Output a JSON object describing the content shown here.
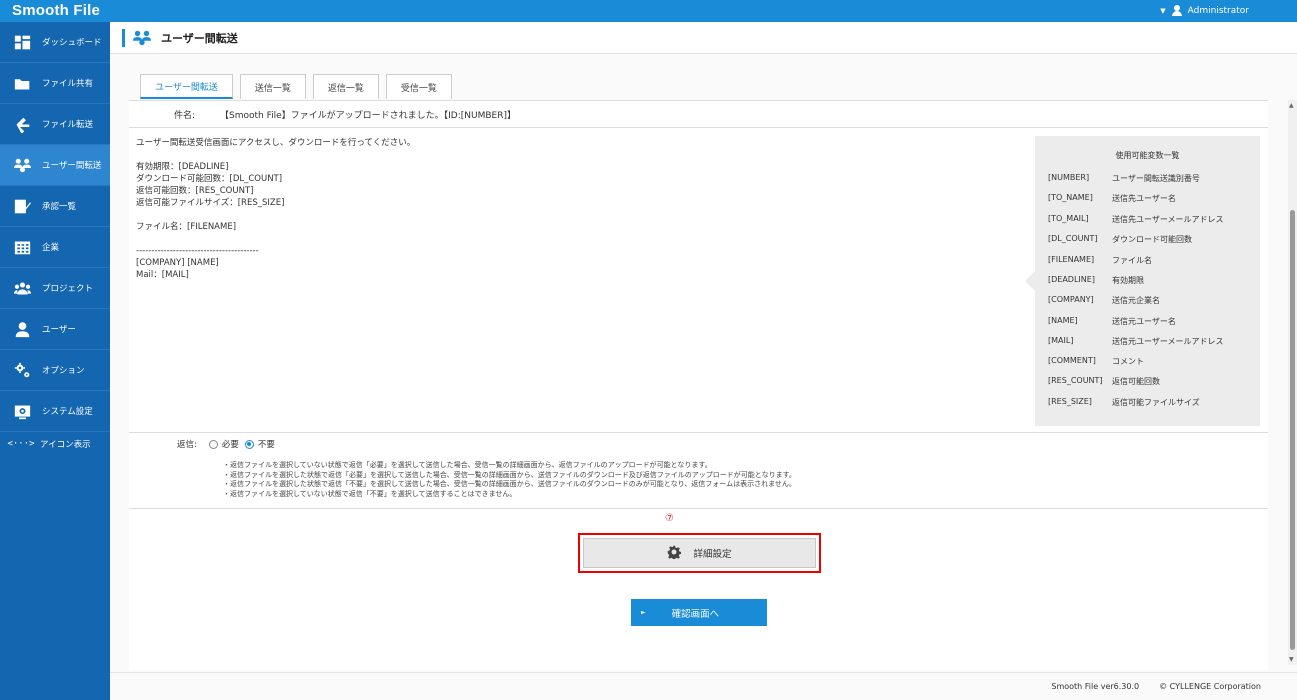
{
  "app": {
    "logo": "Smooth File",
    "user_caret": "▼",
    "user_name": "Administrator"
  },
  "sidebar": {
    "items": [
      {
        "label": "ダッシュボード",
        "icon": "dashboard-icon"
      },
      {
        "label": "ファイル共有",
        "icon": "folder-icon"
      },
      {
        "label": "ファイル転送",
        "icon": "transfer-icon"
      },
      {
        "label": "ユーザー間転送",
        "icon": "user-transfer-icon"
      },
      {
        "label": "承認一覧",
        "icon": "approval-icon"
      },
      {
        "label": "企業",
        "icon": "building-icon"
      },
      {
        "label": "プロジェクト",
        "icon": "project-icon"
      },
      {
        "label": "ユーザー",
        "icon": "user-icon"
      },
      {
        "label": "オプション",
        "icon": "options-icon"
      },
      {
        "label": "システム設定",
        "icon": "system-settings-icon"
      }
    ],
    "icon_toggle": {
      "glyph": "<···>",
      "label": "アイコン表示"
    }
  },
  "header": {
    "title": "ユーザー間転送"
  },
  "tabs": [
    {
      "label": "ユーザー間転送"
    },
    {
      "label": "送信一覧"
    },
    {
      "label": "返信一覧"
    },
    {
      "label": "受信一覧"
    }
  ],
  "subject": {
    "label": "件名:",
    "value": "【Smooth File】ファイルがアップロードされました。【ID:[NUMBER]】"
  },
  "body": {
    "text": "ユーザー間転送受信画面にアクセスし、ダウンロードを行ってください。\n\n有効期限：[DEADLINE]\nダウンロード可能回数：[DL_COUNT]\n返信可能回数：[RES_COUNT]\n返信可能ファイルサイズ：[RES_SIZE]\n\nファイル名：[FILENAME]\n\n----------------------------------------\n[COMPANY] [NAME]\nMail：[MAIL]"
  },
  "variables": {
    "title": "使用可能変数一覧",
    "rows": [
      {
        "key": "[NUMBER]",
        "desc": "ユーザー間転送識別番号"
      },
      {
        "key": "[TO_NAME]",
        "desc": "送信先ユーザー名"
      },
      {
        "key": "[TO_MAIL]",
        "desc": "送信先ユーザーメールアドレス"
      },
      {
        "key": "[DL_COUNT]",
        "desc": "ダウンロード可能回数"
      },
      {
        "key": "[FILENAME]",
        "desc": "ファイル名"
      },
      {
        "key": "[DEADLINE]",
        "desc": "有効期限"
      },
      {
        "key": "[COMPANY]",
        "desc": "送信元企業名"
      },
      {
        "key": "[NAME]",
        "desc": "送信元ユーザー名"
      },
      {
        "key": "[MAIL]",
        "desc": "送信元ユーザーメールアドレス"
      },
      {
        "key": "[COMMENT]",
        "desc": "コメント"
      },
      {
        "key": "[RES_COUNT]",
        "desc": "返信可能回数"
      },
      {
        "key": "[RES_SIZE]",
        "desc": "返信可能ファイルサイズ"
      }
    ]
  },
  "reply": {
    "label": "返信:",
    "option_required": "必要",
    "option_not_required": "不要",
    "selected": "不要",
    "notes": [
      "・返信ファイルを選択していない状態で返信「必要」を選択して送信した場合、受信一覧の詳細画面から、返信ファイルのアップロードが可能となります。",
      "・返信ファイルを選択した状態で返信「必要」を選択して送信した場合、受信一覧の詳細画面から、送信ファイルのダウンロード及び返信ファイルのアップロードが可能となります。",
      "・返信ファイルを選択した状態で返信「不要」を選択して送信した場合、受信一覧の詳細画面から、送信ファイルのダウンロードのみが可能となり、返信フォームは表示されません。",
      "・返信ファイルを選択していない状態で返信「不要」を選択して送信することはできません。"
    ]
  },
  "marker": "⑦",
  "detail_button": {
    "label": "詳細設定"
  },
  "confirm_button": {
    "arrow": "►",
    "label": "確認画面へ"
  },
  "scrollbar": {
    "up": "▲",
    "down": "▼"
  },
  "footer": {
    "version": "Smooth File ver6.30.0",
    "copyright": "© CYLLENGE Corporation"
  },
  "colors": {
    "topbar": "#1a8bd6",
    "sidebar": "#1566b0",
    "sidebar_active": "#2e86d1",
    "accent": "#1a8bd6",
    "highlight_border": "#e00000"
  }
}
